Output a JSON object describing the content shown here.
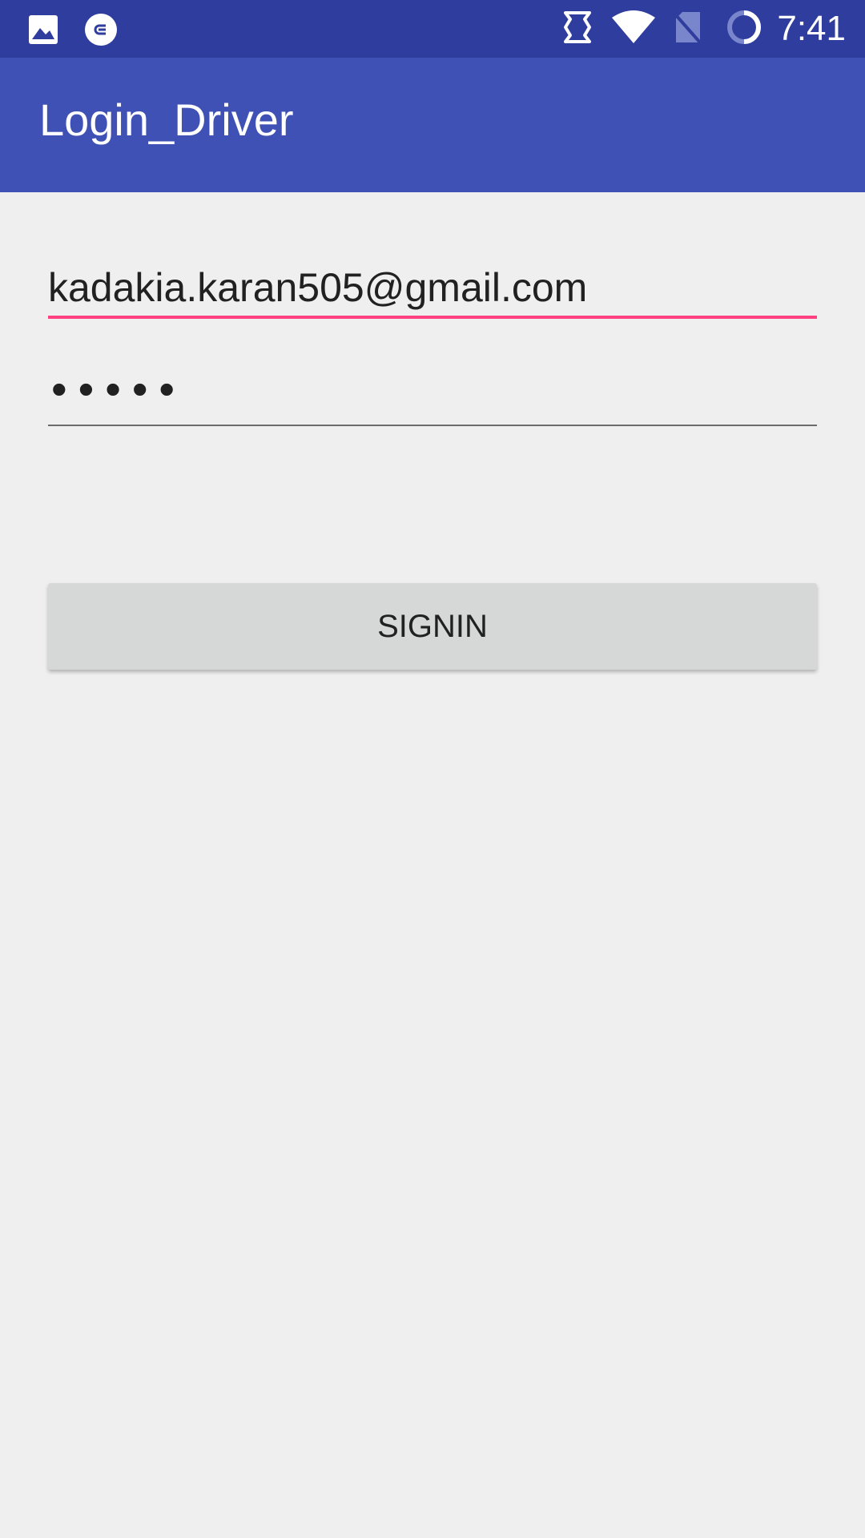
{
  "status_bar": {
    "time": "7:41",
    "icons": [
      "gallery-icon",
      "sync-icon",
      "vibrate-icon",
      "wifi-icon",
      "no-sim-icon",
      "battery-saver-icon"
    ]
  },
  "app_bar": {
    "title": "Login_Driver",
    "color": "#3f51b5"
  },
  "form": {
    "email_value": "kadakia.karan505@gmail.com",
    "password_mask": "•••••",
    "signin_label": "SIGNIN"
  },
  "colors": {
    "status_bar": "#2f3e9e",
    "accent": "#ff4081",
    "button": "#d6d7d7"
  }
}
